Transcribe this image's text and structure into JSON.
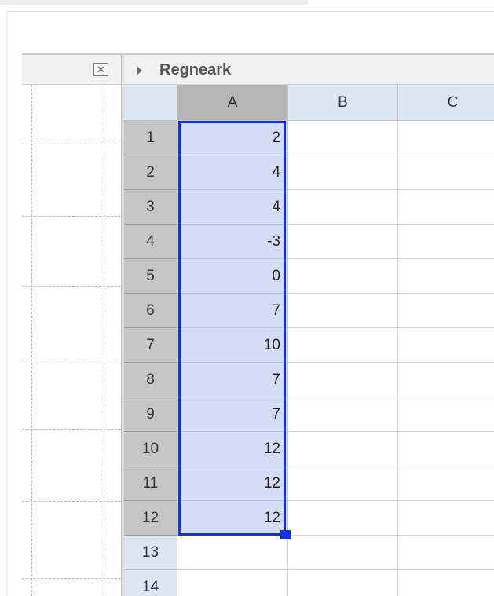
{
  "panel": {
    "title": "Regneark",
    "close_glyph": "✕"
  },
  "sheet": {
    "columns": [
      "A",
      "B",
      "C"
    ],
    "rows": [
      {
        "num": "1",
        "a": "2"
      },
      {
        "num": "2",
        "a": "4"
      },
      {
        "num": "3",
        "a": "4"
      },
      {
        "num": "4",
        "a": "-3"
      },
      {
        "num": "5",
        "a": "0"
      },
      {
        "num": "6",
        "a": "7"
      },
      {
        "num": "7",
        "a": "10"
      },
      {
        "num": "8",
        "a": "7"
      },
      {
        "num": "9",
        "a": "7"
      },
      {
        "num": "10",
        "a": "12"
      },
      {
        "num": "11",
        "a": "12"
      },
      {
        "num": "12",
        "a": "12"
      },
      {
        "num": "13",
        "a": ""
      },
      {
        "num": "14",
        "a": ""
      }
    ],
    "selected_column": "A",
    "selected_rows": "1-12"
  },
  "colors": {
    "selection_border": "#1230e6",
    "selection_fill": "#d3dcf2",
    "selected_header": "#b5b5b5",
    "header_bg": "#dde6f3"
  }
}
